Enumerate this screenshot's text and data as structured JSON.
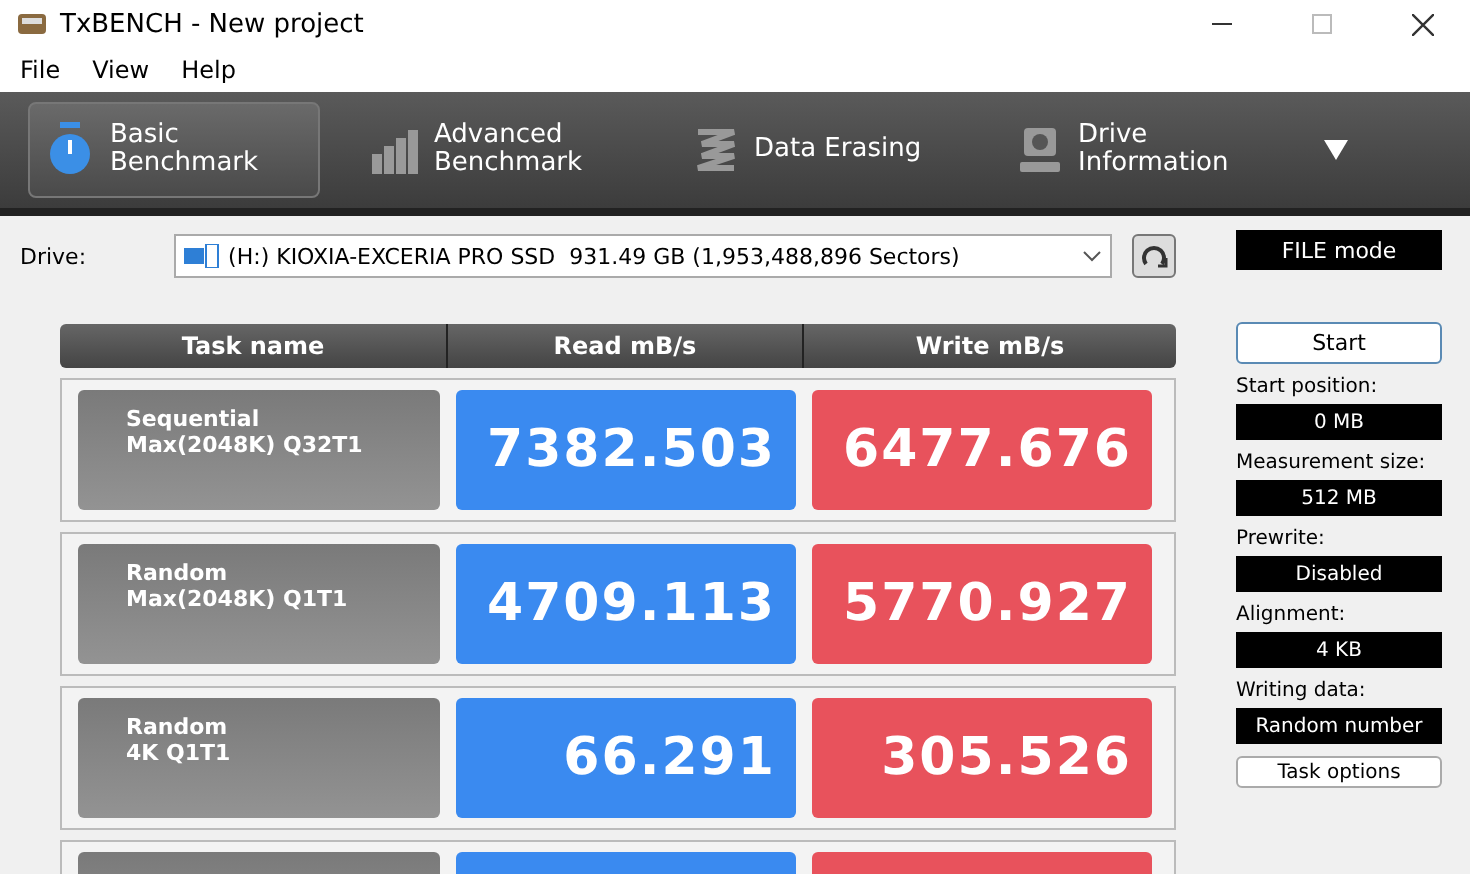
{
  "window": {
    "title": "TxBENCH - New project"
  },
  "menu": [
    "File",
    "View",
    "Help"
  ],
  "tabs": [
    {
      "label": "Basic\nBenchmark",
      "kind": "timer",
      "selected": true
    },
    {
      "label": "Advanced\nBenchmark",
      "kind": "bars",
      "selected": false
    },
    {
      "label": "Data Erasing",
      "kind": "erase",
      "selected": false
    },
    {
      "label": "Drive\nInformation",
      "kind": "drive",
      "selected": false
    }
  ],
  "drive": {
    "label": "Drive:",
    "value": "(H:) KIOXIA-EXCERIA PRO SSD  931.49 GB (1,953,488,896 Sectors)"
  },
  "mode": "FILE mode",
  "table": {
    "columns": [
      "Task name",
      "Read mB/s",
      "Write mB/s"
    ],
    "rows": [
      {
        "name": "Sequential\nMax(2048K) Q32T1",
        "read": "7382.503",
        "write": "6477.676"
      },
      {
        "name": "Random\nMax(2048K) Q1T1",
        "read": "4709.113",
        "write": "5770.927"
      },
      {
        "name": "Random\n4K Q1T1",
        "read": "66.291",
        "write": "305.526"
      },
      {}
    ]
  },
  "start_button": "Start",
  "settings": [
    {
      "label": "Start position:",
      "value": "0 MB"
    },
    {
      "label": "Measurement size:",
      "value": "512 MB"
    },
    {
      "label": "Prewrite:",
      "value": "Disabled"
    },
    {
      "label": "Alignment:",
      "value": "4 KB"
    },
    {
      "label": "Writing data:",
      "value": "Random number"
    }
  ],
  "task_options_button": "Task options"
}
